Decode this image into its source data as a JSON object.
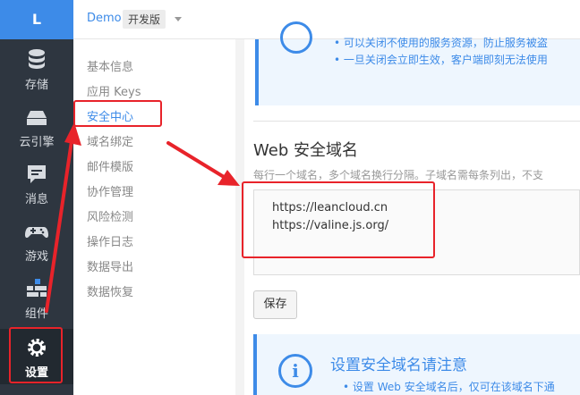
{
  "rail": {
    "logo": "L",
    "items": [
      {
        "label": "存储",
        "icon": "database-icon"
      },
      {
        "label": "云引擎",
        "icon": "server-icon"
      },
      {
        "label": "消息",
        "icon": "message-icon"
      },
      {
        "label": "游戏",
        "icon": "gamepad-icon"
      },
      {
        "label": "组件",
        "icon": "components-icon"
      },
      {
        "label": "设置",
        "icon": "gear-icon"
      }
    ]
  },
  "header": {
    "app_name": "Demo",
    "badge": "开发版"
  },
  "submenu": {
    "items": [
      "基本信息",
      "应用 Keys",
      "安全中心",
      "域名绑定",
      "邮件模版",
      "协作管理",
      "风险检测",
      "操作日志",
      "数据导出",
      "数据恢复"
    ],
    "active_index": 2
  },
  "main": {
    "top_notice": {
      "bullets": [
        "可以关闭不使用的服务资源，防止服务被盗",
        "一旦关闭会立即生效，客户端即刻无法使用"
      ]
    },
    "section_title": "Web 安全域名",
    "hint": "每行一个域名，多个域名换行分隔。子域名需每条列出，不支",
    "domains": [
      "https://leancloud.cn",
      "https://valine.js.org/"
    ],
    "save_label": "保存",
    "bottom_notice": {
      "icon": "i",
      "title": "设置安全域名请注意",
      "bullet": "设置 Web 安全域名后，仅可在该域名下通"
    }
  },
  "colors": {
    "accent": "#3d8be8",
    "rail": "#2e3640",
    "annotation": "#e8232a"
  }
}
